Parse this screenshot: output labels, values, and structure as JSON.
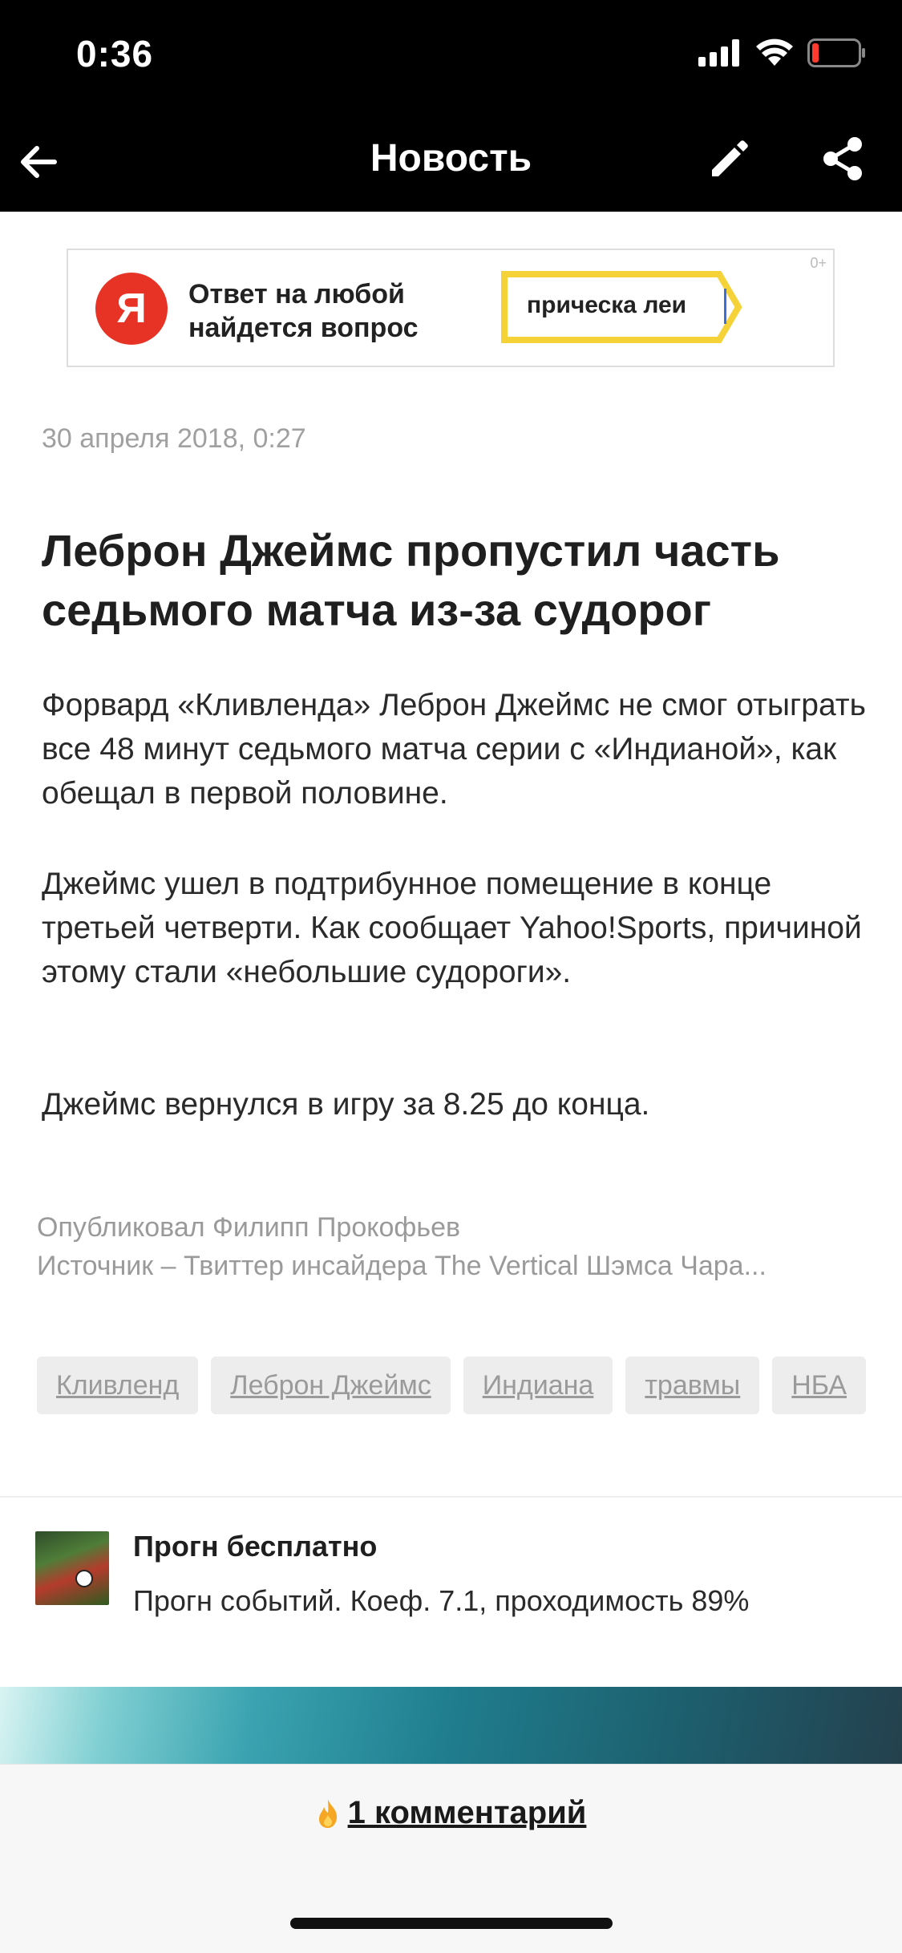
{
  "status_bar": {
    "time": "0:36",
    "icons": [
      "signal-icon",
      "wifi-icon",
      "battery-low-icon"
    ],
    "battery_color": "#ff3b30"
  },
  "nav": {
    "title": "Новость",
    "back_icon": "arrow-left-icon",
    "edit_icon": "pencil-icon",
    "share_icon": "share-icon"
  },
  "ad": {
    "logo_letter": "Я",
    "text_line1": "Ответ на любой",
    "text_line2": "найдется вопрос",
    "query": "прическа леи",
    "age_rating": "0+",
    "logo_color": "#e73325",
    "accent_color": "#f5d338"
  },
  "article": {
    "date": "30 апреля 2018, 0:27",
    "headline": "Леброн Джеймс пропустил часть седьмого матча из-за судорог",
    "paragraphs": [
      "Форвард «Кливленда» Леброн Джеймс не смог отыграть все 48 минут седьмого матча серии с «Индианой», как обещал в первой половине.",
      "Джеймс ушел в подтрибунное помещение в конце третьей четверти. Как сообщает Yahoo!Sports, причиной этому стали «небольшие судороги».",
      "Джеймс вернулся в игру за 8.25 до конца."
    ],
    "author_line": "Опубликовал Филипп Прокофьев",
    "source_line": "Источник –  Твиттер инсайдера The Vertical Шэмса Чара..."
  },
  "tags": [
    "Кливленд",
    "Леброн Джеймс",
    "Индиана",
    "травмы",
    "НБА"
  ],
  "promo": {
    "title": "Прогн бесплатно",
    "description": "Прогн событий. Коеф. 7.1, проходимость 89%"
  },
  "footer": {
    "comments_label": "1 комментарий",
    "comments_icon": "fire-icon"
  }
}
